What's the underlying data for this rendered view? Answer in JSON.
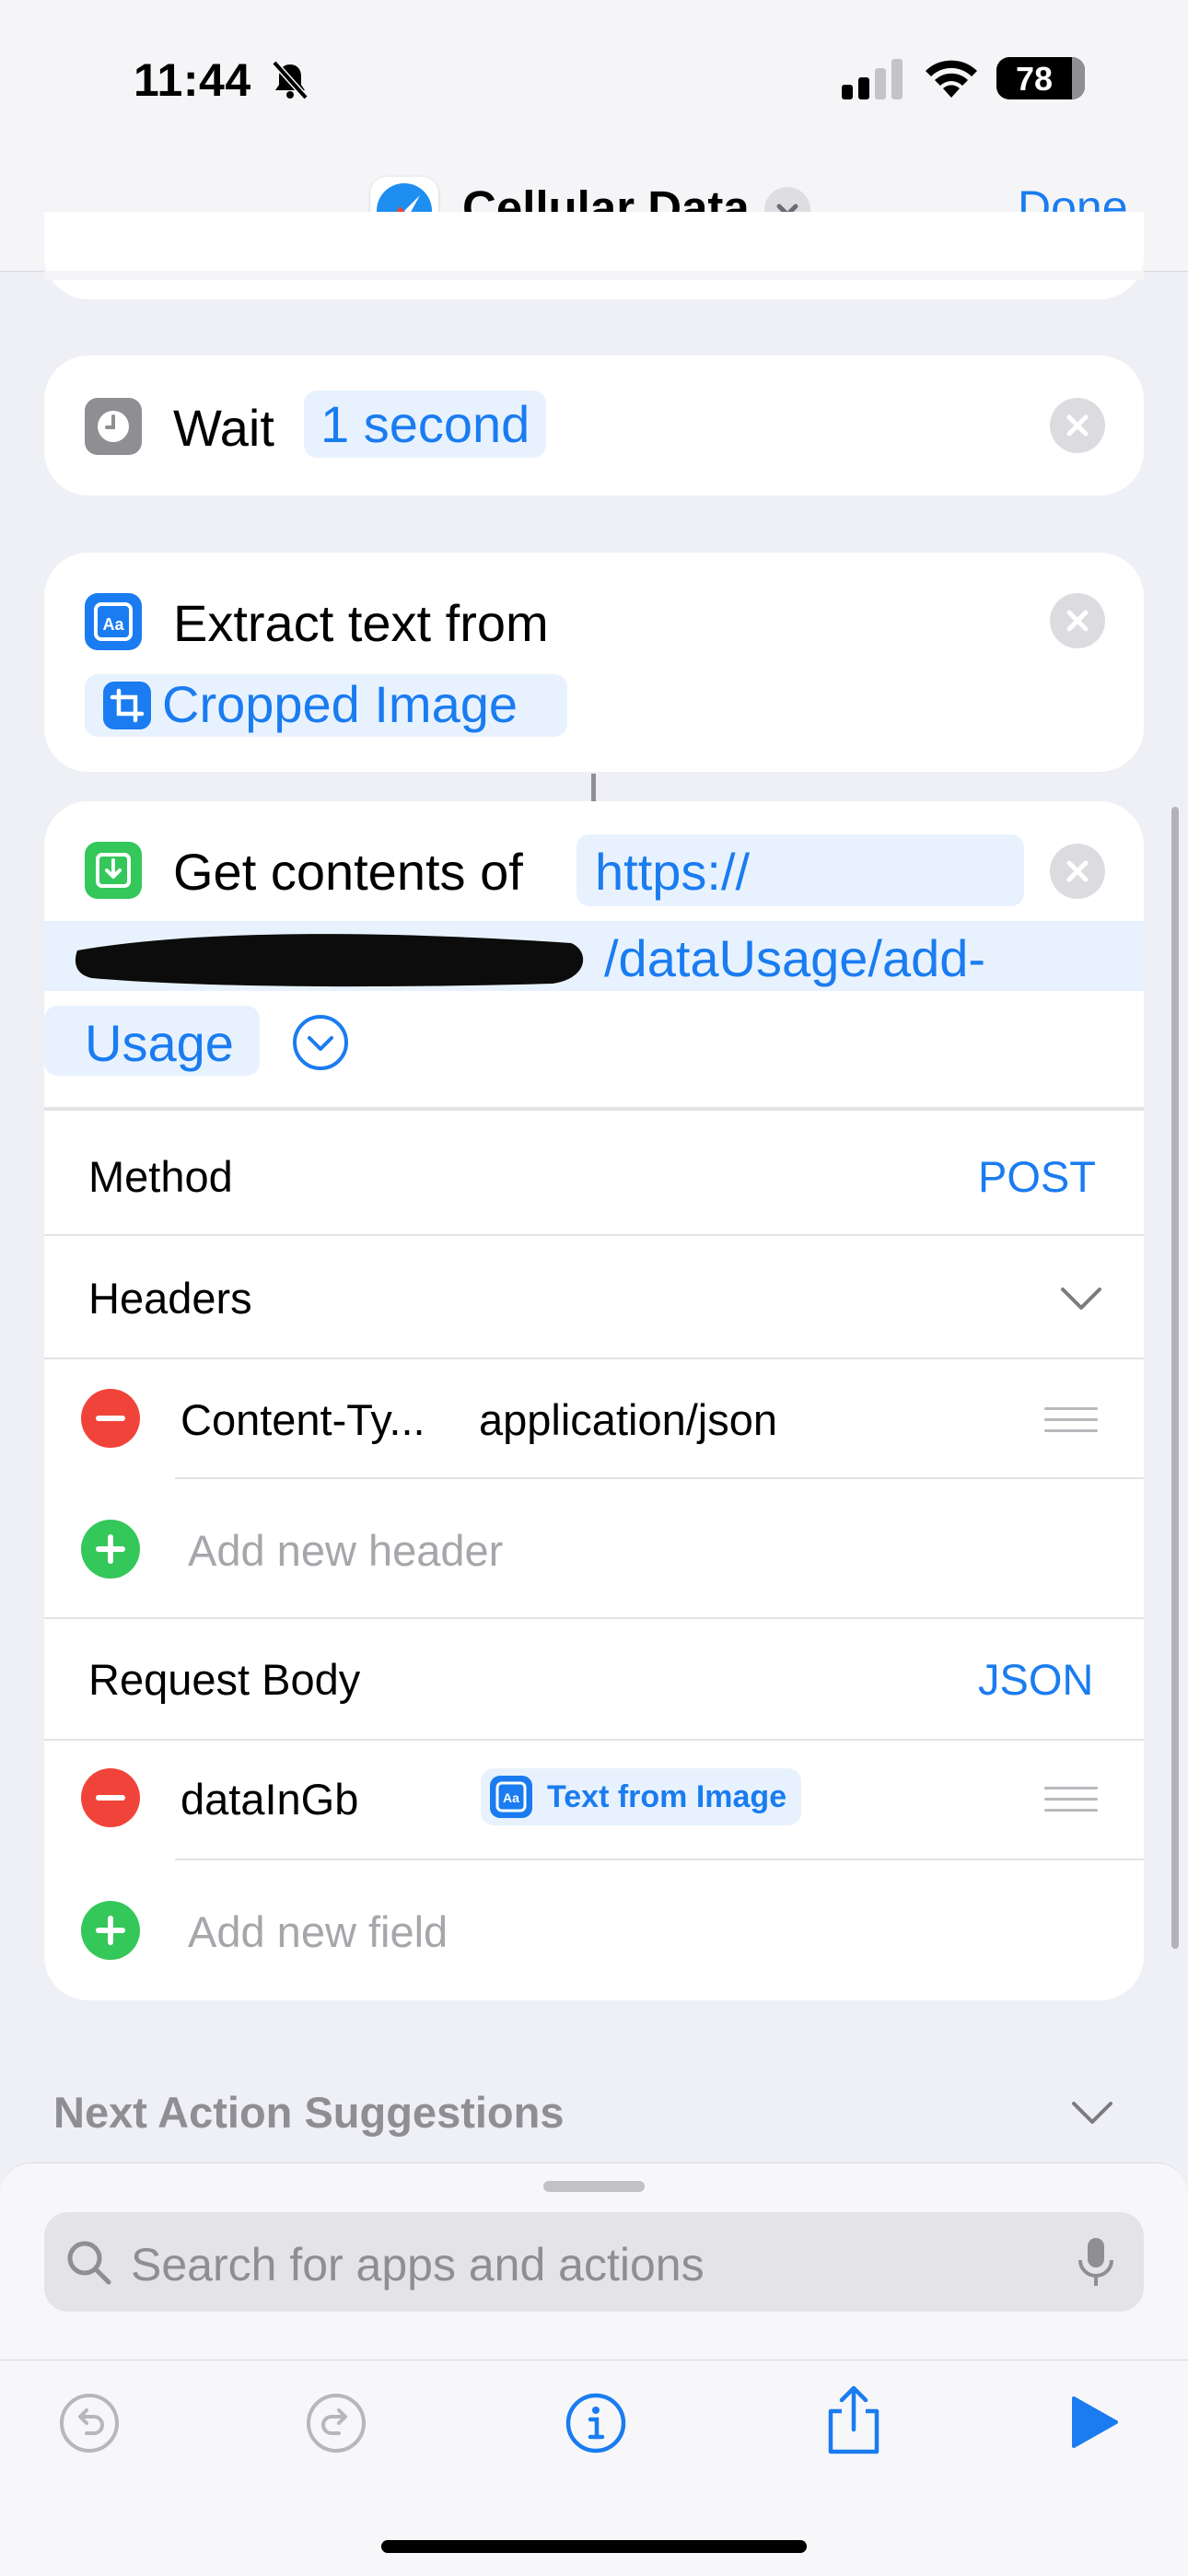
{
  "status_bar": {
    "time": "11:44",
    "battery": "78"
  },
  "nav": {
    "title": "Cellular Data",
    "done_label": "Done"
  },
  "wait_action": {
    "label": "Wait",
    "value": "1 second"
  },
  "extract_action": {
    "label": "Extract text from",
    "input": "Cropped Image"
  },
  "get_contents_action": {
    "label": "Get contents of",
    "url_line1": "https://",
    "url_line2": "/dataUsage/add-",
    "url_line3": "Usage",
    "method_label": "Method",
    "method_value": "POST",
    "headers_label": "Headers",
    "headers": [
      {
        "key": "Content-Ty...",
        "value": "application/json"
      }
    ],
    "add_header_placeholder": "Add new header",
    "body_label": "Request Body",
    "body_type": "JSON",
    "fields": [
      {
        "key": "dataInGb",
        "value": "Text from Image"
      }
    ],
    "add_field_placeholder": "Add new field"
  },
  "suggestions": {
    "label": "Next Action Suggestions"
  },
  "search": {
    "placeholder": "Search for apps and actions"
  },
  "icons": [
    "safari-icon",
    "clock-icon",
    "text-recognition-icon",
    "crop-icon",
    "download-icon",
    "undo-icon",
    "redo-icon",
    "info-icon",
    "share-icon",
    "play-icon",
    "mic-icon"
  ],
  "colors": {
    "accent": "#1a7cf0",
    "remove": "#f0443a",
    "add": "#34c759"
  }
}
